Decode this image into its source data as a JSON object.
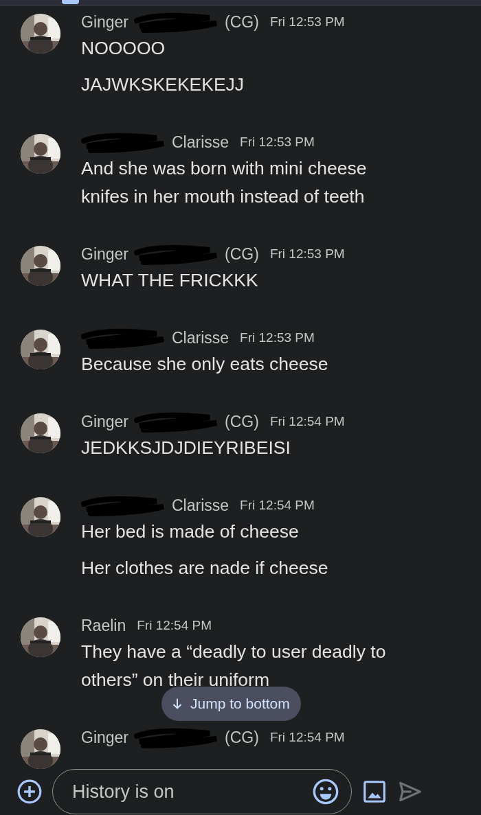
{
  "messages": [
    {
      "author": [
        {
          "kind": "text",
          "text": "Ginger"
        },
        {
          "kind": "redaction"
        },
        {
          "kind": "text",
          "text": "(CG)"
        }
      ],
      "time": "Fri 12:53 PM",
      "texts": [
        "NOOOOO",
        "JAJWKSKEKEKEJJ"
      ]
    },
    {
      "author": [
        {
          "kind": "redaction"
        },
        {
          "kind": "text",
          "text": "Clarisse"
        }
      ],
      "time": "Fri 12:53 PM",
      "texts": [
        "And she was born with mini cheese knifes in her mouth instead of teeth"
      ]
    },
    {
      "author": [
        {
          "kind": "text",
          "text": "Ginger"
        },
        {
          "kind": "redaction"
        },
        {
          "kind": "text",
          "text": "(CG)"
        }
      ],
      "time": "Fri 12:53 PM",
      "texts": [
        "WHAT THE FRICKKK"
      ]
    },
    {
      "author": [
        {
          "kind": "redaction"
        },
        {
          "kind": "text",
          "text": "Clarisse"
        }
      ],
      "time": "Fri 12:53 PM",
      "texts": [
        "Because she only eats cheese"
      ]
    },
    {
      "author": [
        {
          "kind": "text",
          "text": "Ginger"
        },
        {
          "kind": "redaction"
        },
        {
          "kind": "text",
          "text": "(CG)"
        }
      ],
      "time": "Fri 12:54 PM",
      "texts": [
        "JEDKKSJDJDIEYRIBEISI"
      ]
    },
    {
      "author": [
        {
          "kind": "redaction"
        },
        {
          "kind": "text",
          "text": "Clarisse"
        }
      ],
      "time": "Fri 12:54 PM",
      "texts": [
        "Her bed is made of cheese",
        "Her clothes are nade if cheese"
      ]
    },
    {
      "author": [
        {
          "kind": "text",
          "text": "Raelin"
        }
      ],
      "time": "Fri 12:54 PM",
      "texts": [
        "They have a “deadly to user deadly to others” on their uniform"
      ]
    },
    {
      "author": [
        {
          "kind": "text",
          "text": "Ginger"
        },
        {
          "kind": "redaction"
        },
        {
          "kind": "text",
          "text": "(CG)"
        }
      ],
      "time": "Fri 12:54 PM"
    }
  ],
  "jump_button": {
    "label": "Jump to bottom"
  },
  "composer": {
    "placeholder": "History is on"
  }
}
